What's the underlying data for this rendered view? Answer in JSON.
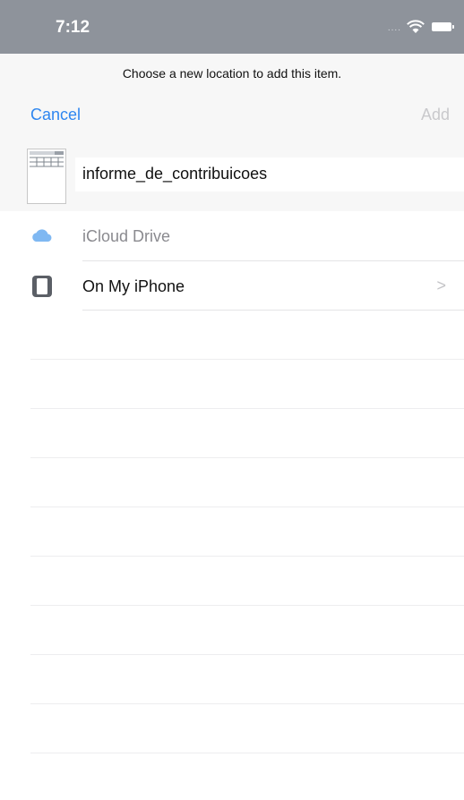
{
  "status_bar": {
    "time": "7:12",
    "signal": "....",
    "icons": [
      "wifi-icon",
      "battery-icon"
    ],
    "background": "#8e939b"
  },
  "header": {
    "prompt": "Choose a new location to add this item.",
    "cancel_label": "Cancel",
    "add_label": "Add",
    "accent_color": "#2e86f0"
  },
  "file": {
    "name": "informe_de_contribuicoes",
    "icon": "spreadsheet-thumbnail"
  },
  "locations": [
    {
      "label": "iCloud Drive",
      "icon": "icloud-icon",
      "enabled": false
    },
    {
      "label": "On My iPhone",
      "icon": "iphone-icon",
      "chevron": ">",
      "enabled": true
    }
  ]
}
